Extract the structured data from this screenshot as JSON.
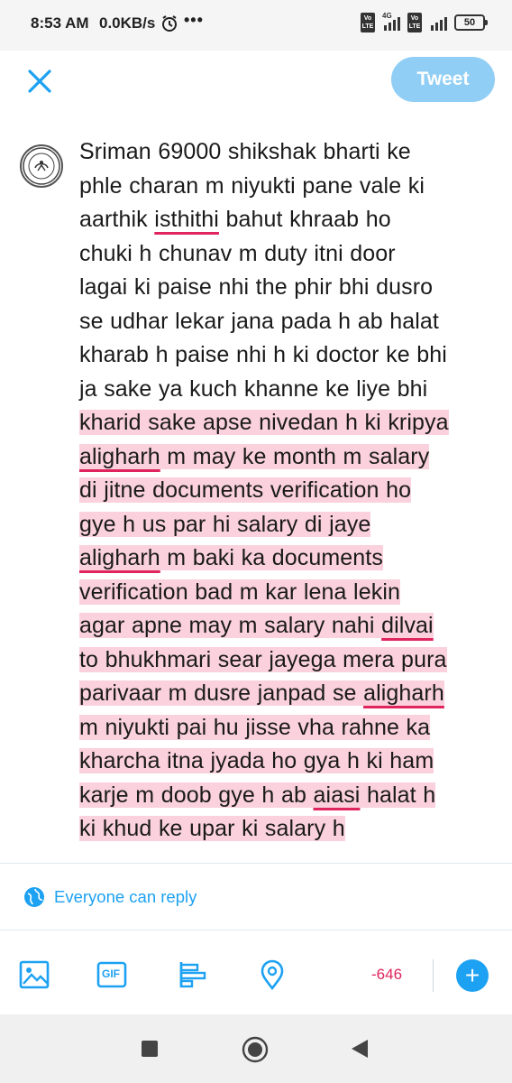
{
  "status_bar": {
    "time": "8:53 AM",
    "net_speed": "0.0KB/s",
    "dots": "•••",
    "sim1_label": "Vo LTE",
    "signal1_label": "4G",
    "sim2_label": "Vo LTE",
    "battery": "50"
  },
  "compose": {
    "tweet_label": "Tweet",
    "tweet_button_color": "#91cef5",
    "text_lines": [
      {
        "parts": [
          {
            "t": "Sriman 69000 shikshak bharti ke"
          }
        ]
      },
      {
        "parts": [
          {
            "t": "phle charan m niyukti pane vale ki"
          }
        ]
      },
      {
        "parts": [
          {
            "t": "aarthik "
          },
          {
            "t": "isthithi",
            "err": true
          },
          {
            "t": " bahut khraab ho"
          }
        ]
      },
      {
        "parts": [
          {
            "t": "chuki h chunav m duty itni door"
          }
        ]
      },
      {
        "parts": [
          {
            "t": "lagai ki paise nhi the phir bhi dusro"
          }
        ]
      },
      {
        "parts": [
          {
            "t": "se udhar lekar jana pada h ab halat"
          }
        ]
      },
      {
        "parts": [
          {
            "t": "kharab h paise nhi h ki doctor ke bhi"
          }
        ]
      },
      {
        "parts": [
          {
            "t": "ja sake ya kuch khanne ke liye bhi"
          }
        ]
      },
      {
        "over": true,
        "parts": [
          {
            "t": "kharid sake apse nivedan h ki kripya"
          }
        ]
      },
      {
        "over": true,
        "parts": [
          {
            "t": "aligharh",
            "err": true
          },
          {
            "t": " m may ke month m salary"
          }
        ]
      },
      {
        "over": true,
        "parts": [
          {
            "t": "di jitne documents verification ho"
          }
        ]
      },
      {
        "over": true,
        "parts": [
          {
            "t": "gye h us par hi salary di jaye"
          }
        ]
      },
      {
        "over": true,
        "parts": [
          {
            "t": "aligharh",
            "err": true
          },
          {
            "t": " m baki ka documents"
          }
        ]
      },
      {
        "over": true,
        "parts": [
          {
            "t": "verification bad m kar lena lekin"
          }
        ]
      },
      {
        "over": true,
        "parts": [
          {
            "t": "agar apne may m salary nahi "
          },
          {
            "t": "dilvai",
            "err": true
          }
        ]
      },
      {
        "over": true,
        "parts": [
          {
            "t": "to bhukhmari sear jayega mera pura"
          }
        ]
      },
      {
        "over": true,
        "parts": [
          {
            "t": "parivaar m dusre janpad se "
          },
          {
            "t": "aligharh",
            "err": true
          }
        ]
      },
      {
        "over": true,
        "parts": [
          {
            "t": "m niyukti pai hu jisse vha rahne ka"
          }
        ]
      },
      {
        "over": true,
        "parts": [
          {
            "t": "kharcha itna jyada ho gya h ki ham"
          }
        ]
      },
      {
        "over": true,
        "parts": [
          {
            "t": "karje m doob gye h ab "
          },
          {
            "t": "aiasi",
            "err": true
          },
          {
            "t": " halat h"
          }
        ]
      },
      {
        "over": true,
        "parts": [
          {
            "t": "ki khud ke upar ki salary h"
          }
        ]
      }
    ],
    "overflow_highlight_color": "#fad1dd",
    "error_underline_color": "#e0245e"
  },
  "reply_setting": {
    "label": "Everyone can reply",
    "icon": "globe-icon",
    "color": "#1da1f2"
  },
  "toolbar": {
    "icons": [
      "image-icon",
      "gif-icon",
      "poll-icon",
      "location-icon"
    ],
    "gif_label": "GIF",
    "char_counter": "-646",
    "counter_color": "#e0245e",
    "add_icon": "plus-icon",
    "add_label": "+",
    "accent": "#1da1f2"
  },
  "nav_bar": {
    "icons": [
      "recents-square-icon",
      "home-circle-icon",
      "back-triangle-icon"
    ]
  }
}
